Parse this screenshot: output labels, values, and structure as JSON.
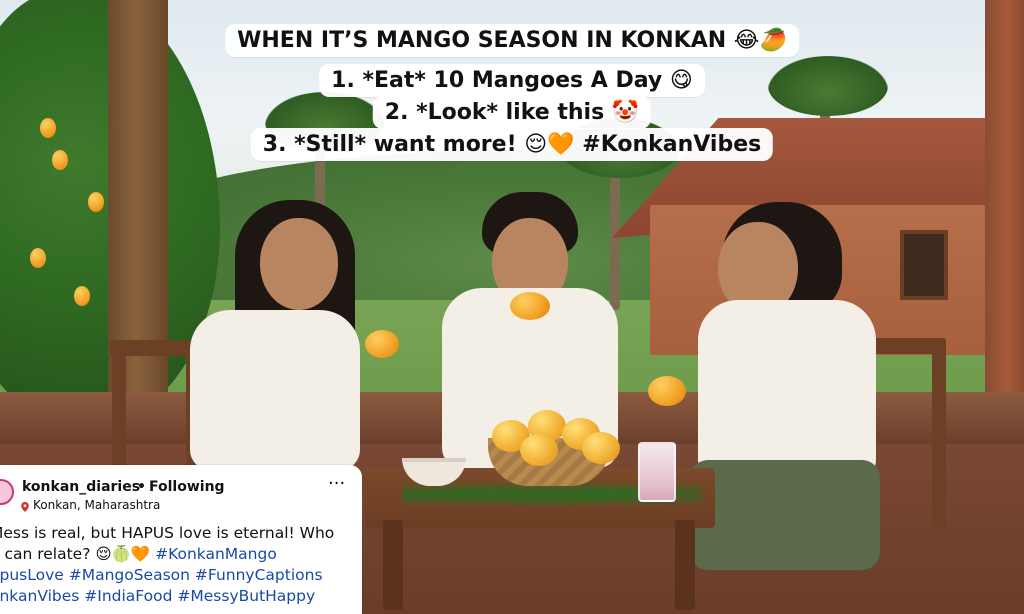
{
  "meme": {
    "line1": "WHEN IT’S MANGO SEASON IN KONKAN 😂🥭",
    "line2": "1. *Eat* 10 Mangoes A Day 😋",
    "line3": "2. *Look* like this 🤡",
    "line4": "3. *Still* want more! 😌🧡 #KonkanVibes"
  },
  "post": {
    "handle": "konkan_diaries",
    "separator": "•",
    "following": "Following",
    "more_label": "···",
    "location": "Konkan, Maharashtra",
    "caption": {
      "prefix": "Mess is real, but HAPUS love is eternal! Who",
      "prefix2": "e can relate? 😌🍈🧡",
      "hashtags_line2": "#KonkanMango",
      "hashtags_line3": "apusLove #MangoSeason #FunnyCaptions",
      "hashtags_line4": "onkanVibes #IndiaFood #MessyButHappy"
    }
  },
  "colors": {
    "card_bg": "#ffffff",
    "hashtag": "#1a49a8",
    "pin": "#d2362f",
    "caption_box": "#ffffff"
  },
  "icons": {
    "avatar": "profile-avatar-icon",
    "more": "more-options-icon",
    "location": "location-pin-icon"
  }
}
